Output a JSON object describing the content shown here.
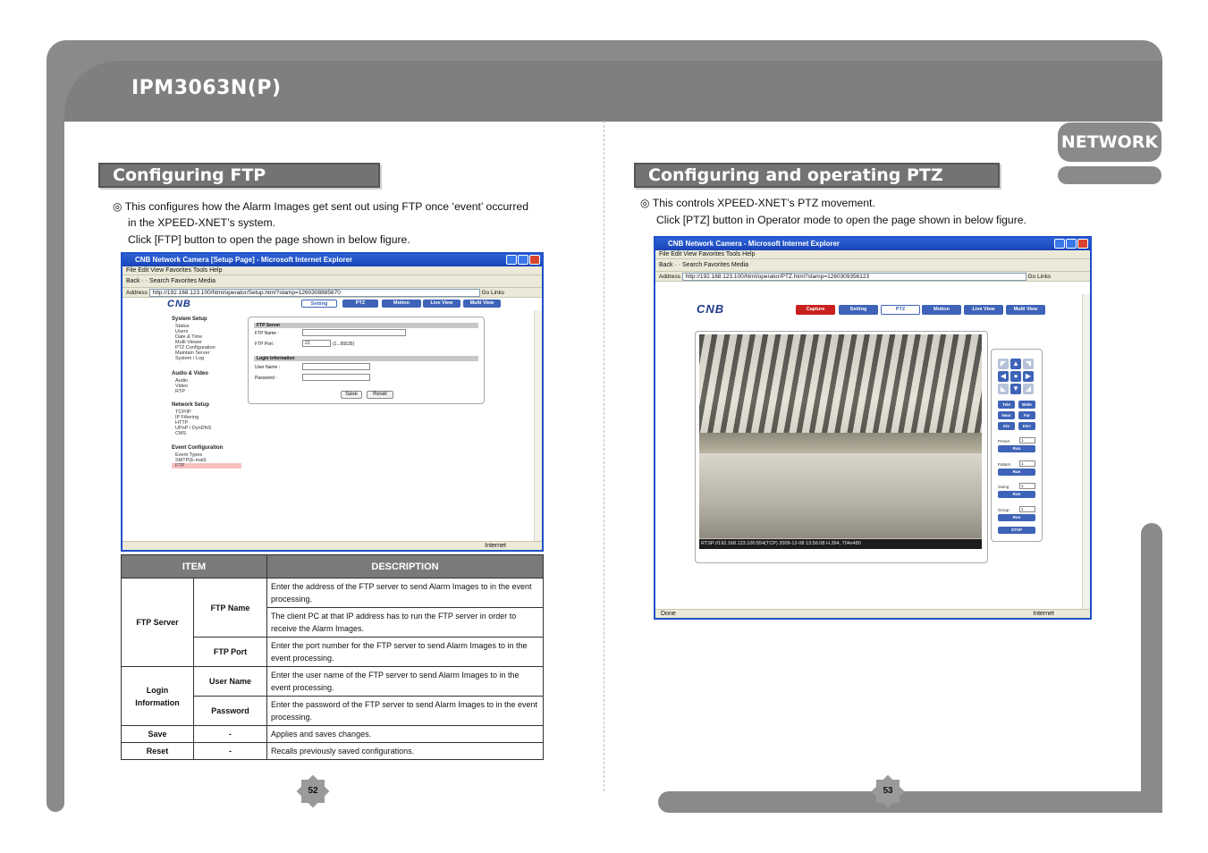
{
  "header": {
    "title": "IPM3063N(P)",
    "section_tab": "NETWORK"
  },
  "left": {
    "heading": "Configuring FTP",
    "intro_line1": "◎ This configures how the Alarm Images get sent out using FTP once ‘event’ occurred",
    "intro_line2": "in the XPEED-XNET’s system.",
    "intro_line3": "Click [FTP] button to open the page shown in below figure.",
    "browser": {
      "title": "CNB Network Camera [Setup Page] - Microsoft Internet Explorer",
      "menu": "File   Edit   View   Favorites   Tools   Help",
      "toolbar": "Back  ·  ·   Search   Favorites   Media",
      "address_label": "Address",
      "address": "http://192.168.123.100/html/operator/Setup.html?stamp=1260308885670",
      "go": "Go",
      "links": "Links",
      "status": "Internet",
      "logo": "CNB",
      "tabs": [
        "Setting",
        "PTZ",
        "Motion",
        "Live View",
        "Multi View"
      ],
      "nav": {
        "system_setup": "System Setup",
        "system_items": [
          "Status",
          "Users",
          "Date & Time",
          "Multi Viewer",
          "PTZ Configuration",
          "Maintain Server",
          "System / Log"
        ],
        "audio_video": "Audio & Video",
        "audio_items": [
          "Audio",
          "Video",
          "RTP"
        ],
        "network_setup": "Network Setup",
        "network_items": [
          "TCP/IP",
          "IP Filtering",
          "HTTP",
          "UPnP / DynDNS",
          "CMS"
        ],
        "event_config": "Event Configuration",
        "event_items": [
          "Event Types",
          "SMTP(E-mail)",
          "FTP"
        ]
      },
      "form": {
        "ftp_server_head": "FTP Server",
        "ftp_name_label": "FTP Name :",
        "ftp_port_label": "FTP Port :",
        "ftp_port_value": "21",
        "ftp_port_range": "(1...65535)",
        "login_head": "Login Information",
        "user_label": "User Name :",
        "pass_label": "Password :",
        "save": "Save",
        "reset": "Reset"
      }
    },
    "table": {
      "headers": [
        "ITEM",
        "DESCRIPTION"
      ],
      "ftp_server": "FTP Server",
      "ftp_name": "FTP Name",
      "ftp_name_desc1": "Enter the address of the FTP server to send Alarm Images to in the event processing.",
      "ftp_name_desc2": "The client PC at that IP address has to run the FTP server in order to receive the Alarm Images.",
      "ftp_port": "FTP Port",
      "ftp_port_desc": "Enter the port number for the FTP server to send Alarm Images to in the event processing.",
      "login_info": "Login Information",
      "user_name": "User Name",
      "user_name_desc": "Enter the user name of the FTP server to send Alarm Images to in the event processing.",
      "password": "Password",
      "password_desc": "Enter the password of the FTP server to send Alarm Images to in the event processing.",
      "save": "Save",
      "save_dash": "-",
      "save_desc": "Applies and saves changes.",
      "reset": "Reset",
      "reset_dash": "-",
      "reset_desc": "Recalls previously saved configurations."
    },
    "page_number": "52"
  },
  "right": {
    "heading": "Configuring and operating PTZ",
    "intro_line1": "◎ This controls XPEED-XNET’s PTZ movement.",
    "intro_line2": "Click [PTZ] button in Operator mode to open the page shown in below figure.",
    "browser": {
      "title": "CNB Network Camera - Microsoft Internet Explorer",
      "menu": "File   Edit   View   Favorites   Tools   Help",
      "toolbar": "Back  ·  ·   Search   Favorites   Media",
      "address_label": "Address",
      "address": "http://192.168.123.100/html/operator/PTZ.html?stamp=1260309356123",
      "go": "Go",
      "links": "Links",
      "status_left": "Done",
      "status_right": "Internet",
      "logo": "CNB",
      "tabs": [
        "Capture",
        "Setting",
        "PTZ",
        "Motion",
        "Live View",
        "Multi View"
      ],
      "video_status": "RTSP://192.168.123.100:554(TCP)          2009-12-08 13:56:08          H.264, 704x480",
      "controls": {
        "tele": "Tele",
        "wide": "Wide",
        "near": "Near",
        "far": "Far",
        "iris": "Iris",
        "iris2": "Iris+",
        "preset": "Preset",
        "pattern": "Pattern",
        "swing": "Swing",
        "group": "Group",
        "select_value": "1",
        "run": "Run",
        "stop": "STOP"
      }
    },
    "page_number": "53"
  }
}
